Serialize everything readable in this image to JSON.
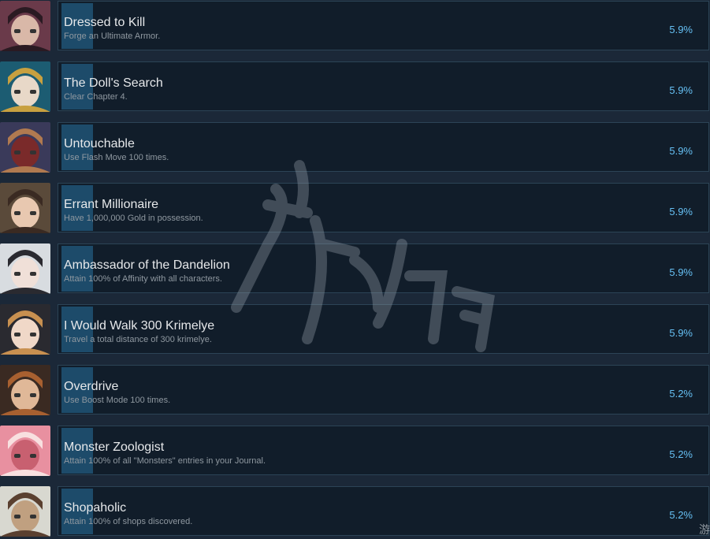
{
  "achievements": [
    {
      "title": "Dressed to Kill",
      "desc": "Forge an Ultimate Armor.",
      "percent": "5.9%",
      "avatar_icon": "masked-character-portrait",
      "colors": [
        "#6a3a4a",
        "#2a1a22",
        "#d9b8a8"
      ]
    },
    {
      "title": "The Doll's Search",
      "desc": "Clear Chapter 4.",
      "percent": "5.9%",
      "avatar_icon": "hat-character-portrait",
      "colors": [
        "#1c5c72",
        "#c8a040",
        "#e8d8c8"
      ]
    },
    {
      "title": "Untouchable",
      "desc": "Use Flash Move 100 times.",
      "percent": "5.9%",
      "avatar_icon": "bald-warrior-portrait",
      "colors": [
        "#3a3a5a",
        "#b07a50",
        "#7a2a2a"
      ]
    },
    {
      "title": "Errant Millionaire",
      "desc": "Have 1,000,000 Gold in possession.",
      "percent": "5.9%",
      "avatar_icon": "brown-hair-portrait",
      "colors": [
        "#5a4a3a",
        "#3a2a22",
        "#e8c8b0"
      ]
    },
    {
      "title": "Ambassador of the Dandelion",
      "desc": "Attain 100% of Affinity with all characters.",
      "percent": "5.9%",
      "avatar_icon": "white-hair-portrait",
      "colors": [
        "#d8dce0",
        "#2a2a30",
        "#f0e0d8"
      ]
    },
    {
      "title": "I Would Walk 300 Krimelye",
      "desc": "Travel a total distance of 300 krimelye.",
      "percent": "5.9%",
      "avatar_icon": "top-hat-portrait",
      "colors": [
        "#2a2a30",
        "#c89050",
        "#f0d8c8"
      ]
    },
    {
      "title": "Overdrive",
      "desc": "Use Boost Mode 100 times.",
      "percent": "5.2%",
      "avatar_icon": "dark-hair-boy-portrait",
      "colors": [
        "#3a2a22",
        "#a86030",
        "#e0b898"
      ]
    },
    {
      "title": "Monster Zoologist",
      "desc": "Attain 100% of all \"Monsters\" entries in your Journal.",
      "percent": "5.2%",
      "avatar_icon": "pink-hair-portrait",
      "colors": [
        "#e890a0",
        "#f8e0e0",
        "#c86070"
      ]
    },
    {
      "title": "Shopaholic",
      "desc": "Attain 100% of shops discovered.",
      "percent": "5.2%",
      "avatar_icon": "owl-merchant-portrait",
      "colors": [
        "#d8d8d0",
        "#5a4030",
        "#c0a080"
      ]
    }
  ],
  "accent_color": "#66c0f4",
  "corner_glyph": "游"
}
